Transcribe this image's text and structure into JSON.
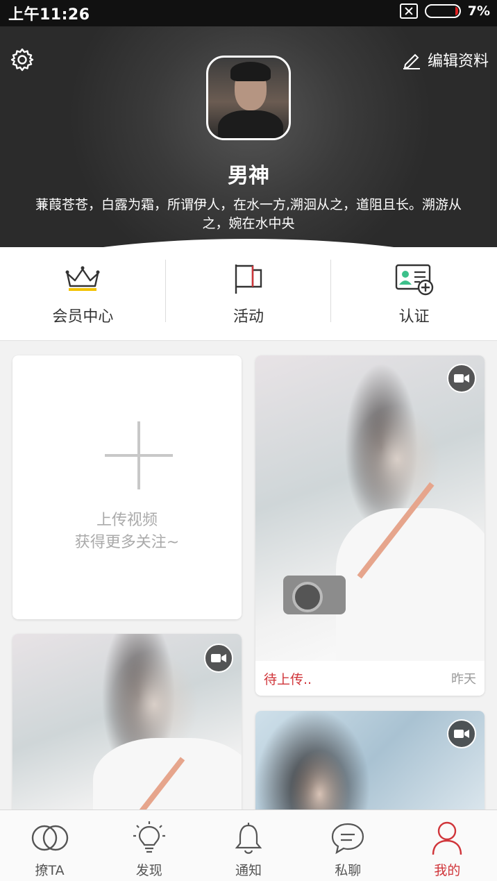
{
  "status_bar": {
    "time": "上午11:26",
    "battery_percent": "7%",
    "battery_level": 0.07
  },
  "header": {
    "edit_label": "编辑资料",
    "name": "男神",
    "bio": "蒹葭苍苍，白露为霜，所谓伊人，在水一方,溯洄从之，道阻且长。溯游从之，婉在水中央"
  },
  "quick_menu": [
    {
      "label": "会员中心",
      "icon": "crown-icon"
    },
    {
      "label": "活动",
      "icon": "flag-icon"
    },
    {
      "label": "认证",
      "icon": "id-card-add-icon"
    }
  ],
  "upload_card": {
    "line1": "上传视频",
    "line2": "获得更多关注~"
  },
  "video_cards": [
    {
      "status": "待上传..",
      "time": "昨天"
    }
  ],
  "bottom_nav": [
    {
      "label": "撩TA",
      "icon": "rings-icon",
      "active": false
    },
    {
      "label": "发现",
      "icon": "lightbulb-icon",
      "active": false
    },
    {
      "label": "通知",
      "icon": "bell-icon",
      "active": false
    },
    {
      "label": "私聊",
      "icon": "chat-icon",
      "active": false
    },
    {
      "label": "我的",
      "icon": "user-icon",
      "active": true
    }
  ],
  "colors": {
    "accent": "#d0353a",
    "crown_gold": "#f2c200",
    "cert_green": "#3cc08a"
  }
}
